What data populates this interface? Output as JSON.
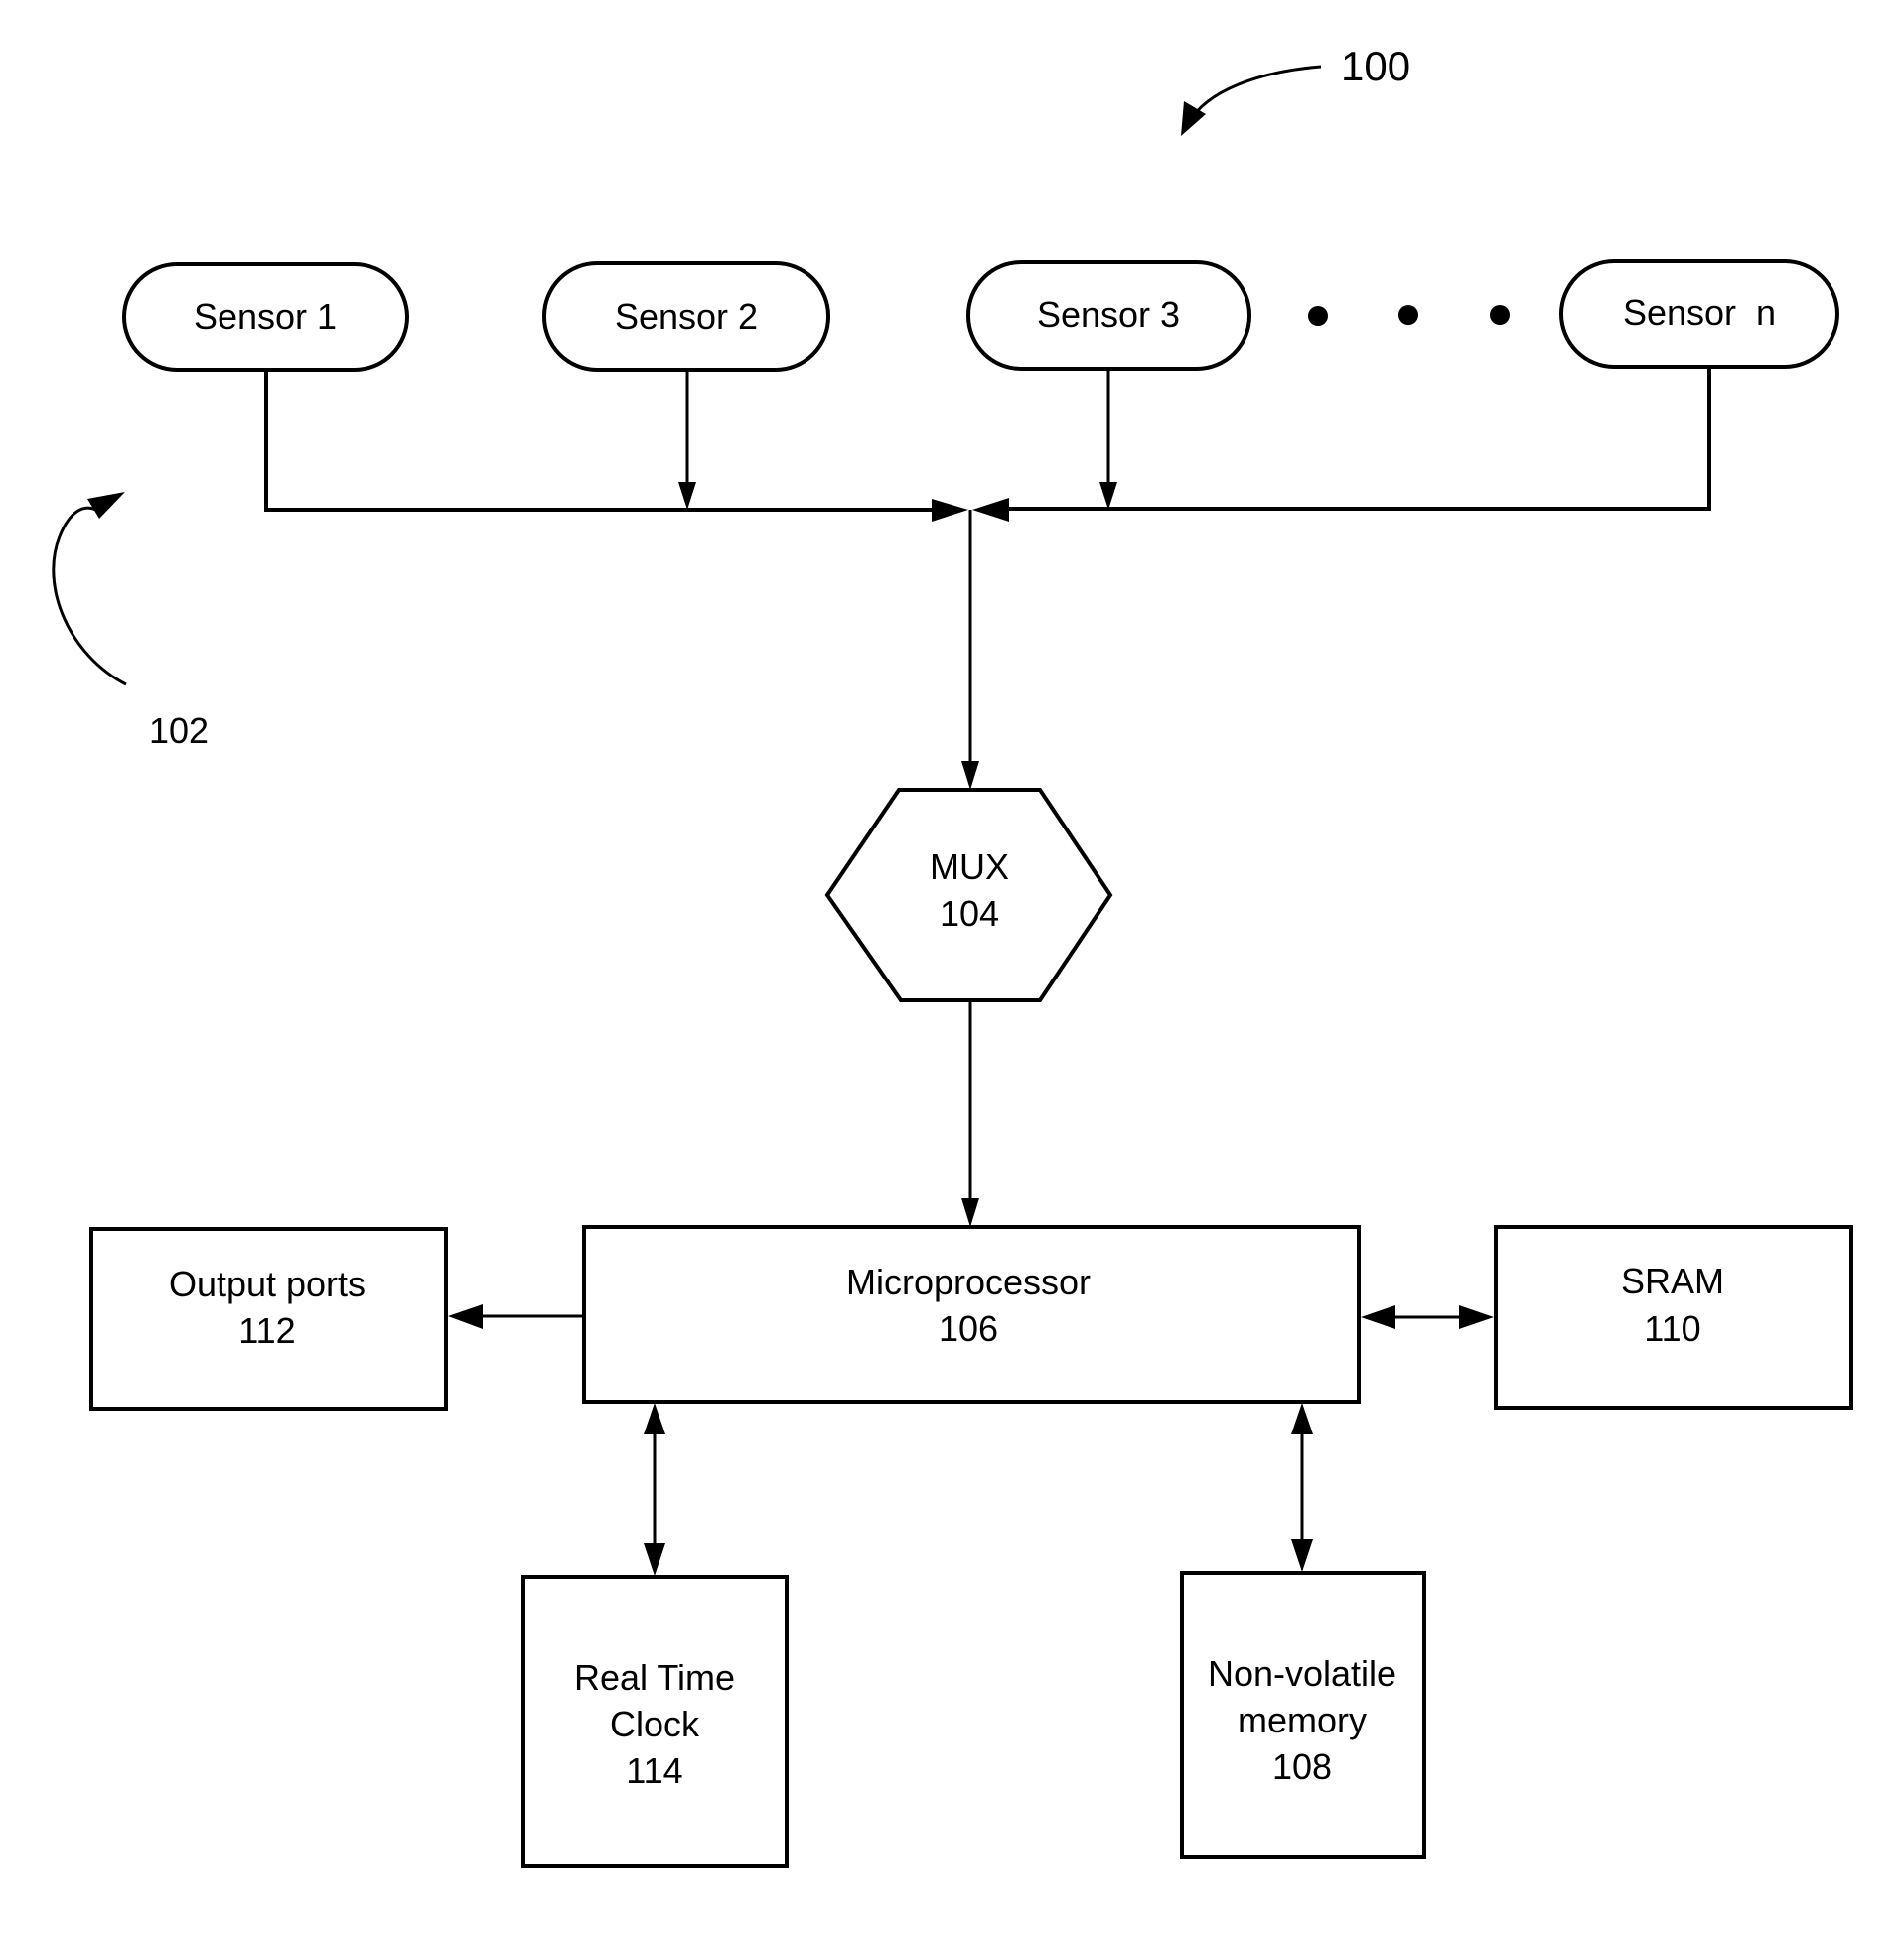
{
  "figure": {
    "reference_label": "100",
    "sensor_group_label": "102",
    "ellipsis": "• • •"
  },
  "sensors": [
    {
      "label": "Sensor 1"
    },
    {
      "label": "Sensor 2"
    },
    {
      "label": "Sensor 3"
    },
    {
      "label": "Sensor  n"
    }
  ],
  "mux": {
    "name": "MUX",
    "ref": "104"
  },
  "microprocessor": {
    "name": "Microprocessor",
    "ref": "106"
  },
  "output_ports": {
    "name": "Output ports",
    "ref": "112"
  },
  "sram": {
    "name": "SRAM",
    "ref": "110"
  },
  "rtc": {
    "line1": "Real Time",
    "line2": "Clock",
    "ref": "114"
  },
  "nvm": {
    "line1": "Non-volatile",
    "line2": "memory",
    "ref": "108"
  },
  "colors": {
    "stroke": "#000000",
    "background": "#ffffff"
  }
}
